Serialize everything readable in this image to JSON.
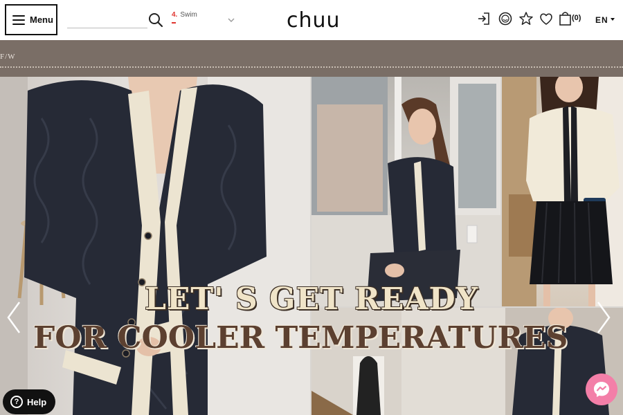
{
  "header": {
    "menu_label": "Menu",
    "search_placeholder": "",
    "trending": {
      "rank": "4.",
      "term": "Swim"
    },
    "logo": "chuu",
    "cart_count": "(0)",
    "language": "EN"
  },
  "category": {
    "label": "F/W"
  },
  "hero": {
    "line1": "LET' S GET READY",
    "line2": "FOR COOLER TEMPERATURES"
  },
  "help": {
    "label": "Help",
    "icon": "?"
  },
  "colors": {
    "strip": "#7a6e66",
    "headline_light": "#f0e4c8",
    "headline_dark": "#5c4030",
    "messenger": "#f37fa8",
    "trend_rank": "#e0342f"
  },
  "icons": [
    "hamburger-icon",
    "search-icon",
    "login-icon",
    "smile-icon",
    "star-icon",
    "heart-icon",
    "shopping-bag-icon",
    "chevron-down-icon",
    "chevron-left-icon",
    "chevron-right-icon",
    "help-icon",
    "messenger-icon"
  ]
}
